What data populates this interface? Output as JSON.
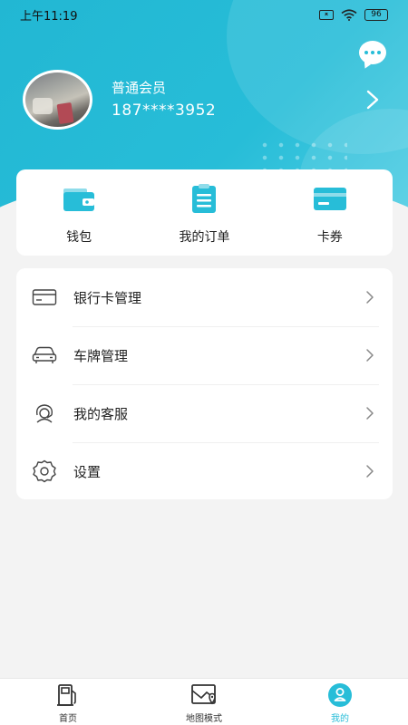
{
  "status_bar": {
    "time": "上午11:19",
    "battery": "96"
  },
  "profile": {
    "member_level": "普通会员",
    "phone": "187****3952"
  },
  "quick_actions": [
    {
      "label": "钱包",
      "icon": "wallet-icon"
    },
    {
      "label": "我的订单",
      "icon": "order-icon"
    },
    {
      "label": "卡券",
      "icon": "card-icon"
    }
  ],
  "menu": [
    {
      "label": "银行卡管理",
      "icon": "bank-card-icon"
    },
    {
      "label": "车牌管理",
      "icon": "car-icon"
    },
    {
      "label": "我的客服",
      "icon": "customer-service-icon"
    },
    {
      "label": "设置",
      "icon": "gear-icon"
    }
  ],
  "tabs": [
    {
      "label": "首页",
      "icon": "gas-station-icon",
      "active": false
    },
    {
      "label": "地图模式",
      "icon": "map-icon",
      "active": false
    },
    {
      "label": "我的",
      "icon": "profile-icon",
      "active": true
    }
  ],
  "colors": {
    "accent": "#27bdd8",
    "background": "#f3f3f3"
  }
}
